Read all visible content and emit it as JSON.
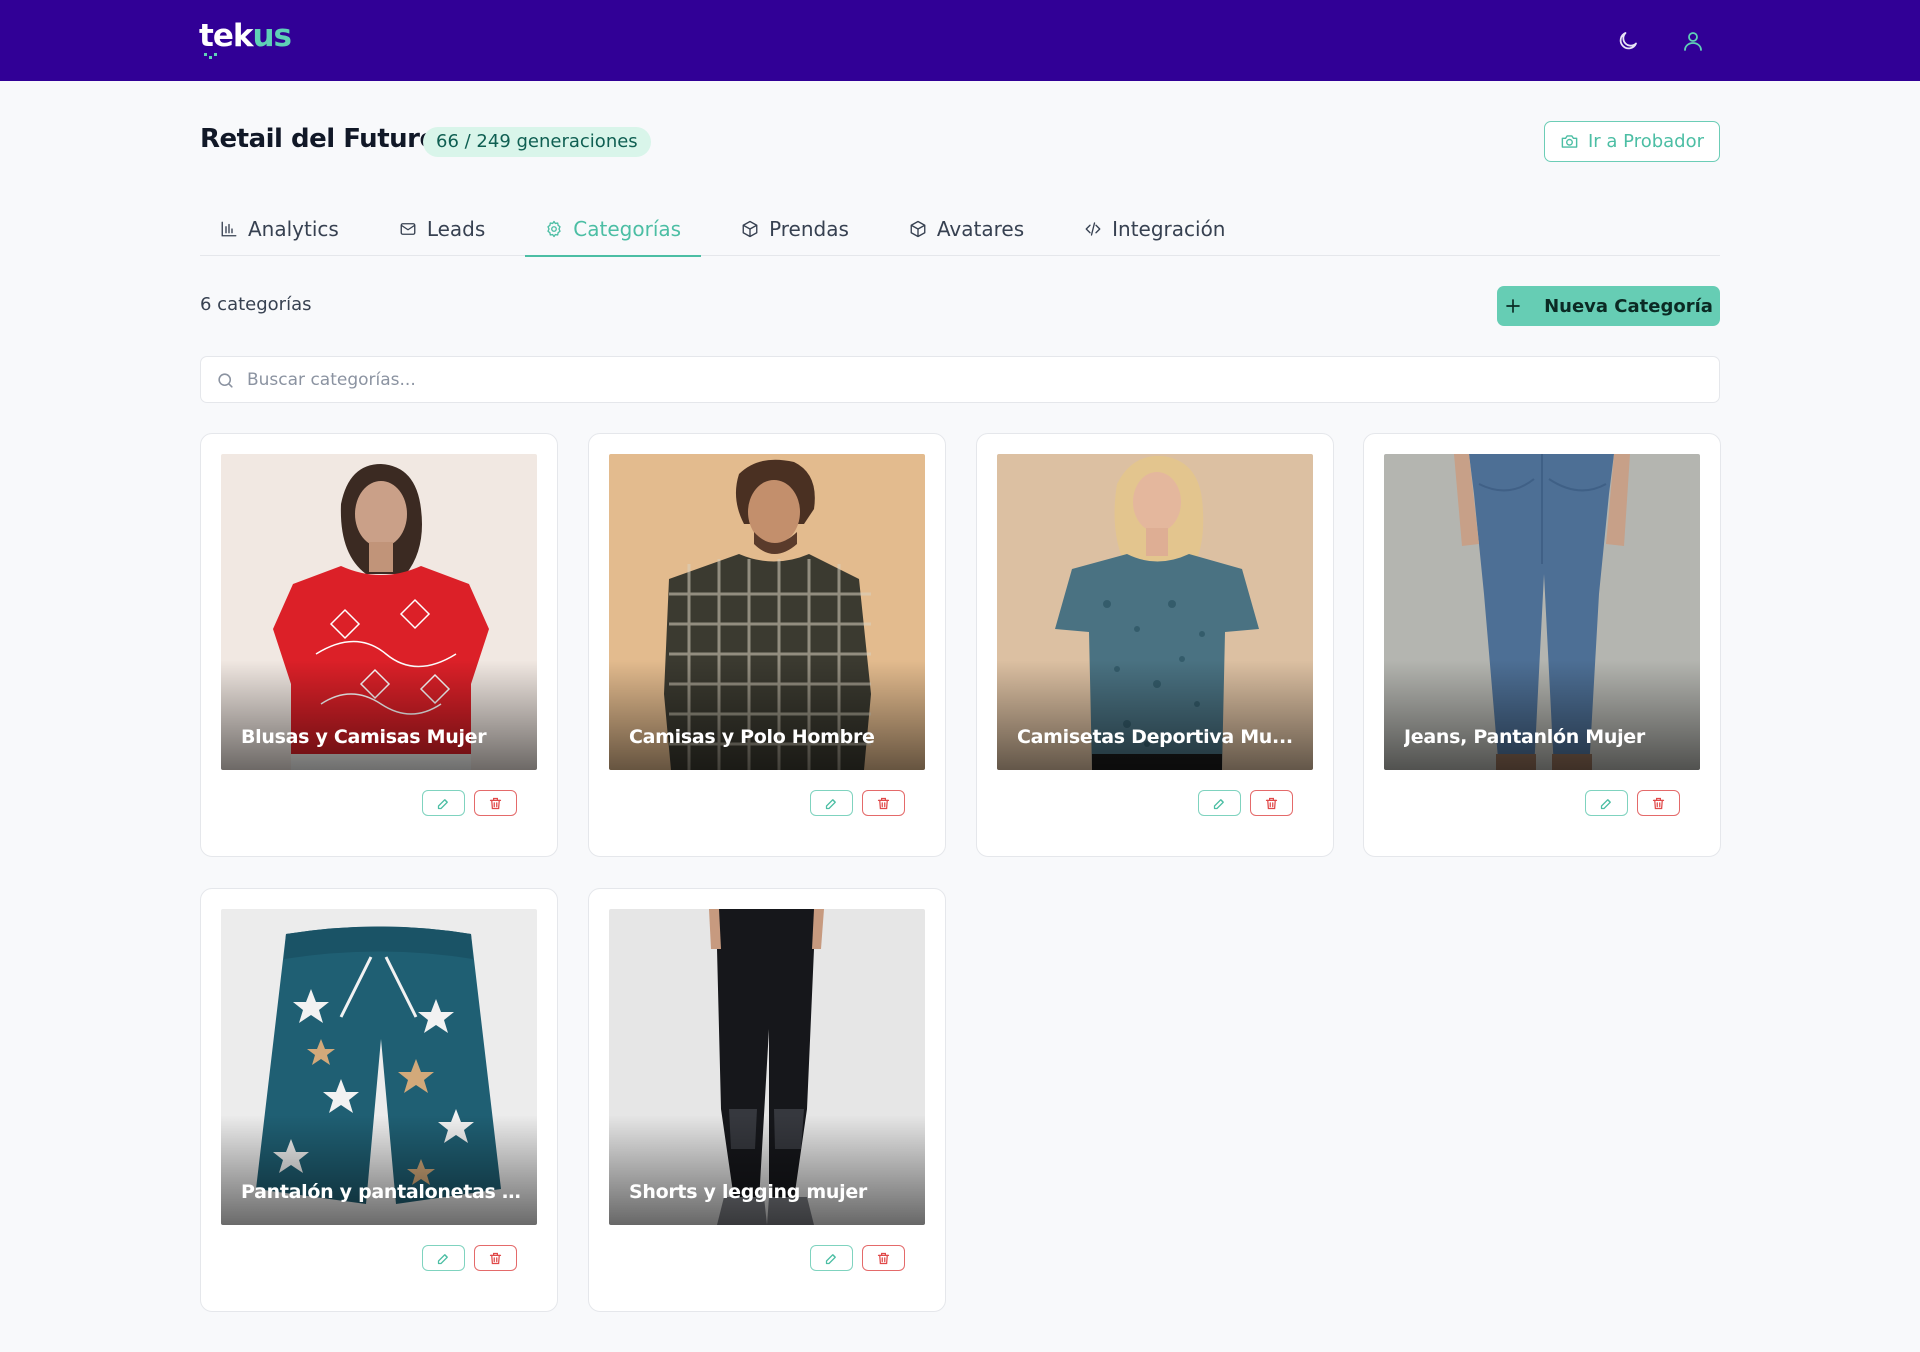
{
  "brand": {
    "logo_text_a": "tek",
    "logo_text_b": "us",
    "colors": {
      "topbar": "#310096",
      "accent": "#66cdb4",
      "danger": "#e46a6a"
    }
  },
  "topbar": {
    "icons": [
      "moon-icon",
      "user-icon"
    ]
  },
  "header": {
    "title": "Retail del Futuro",
    "generations": "66 / 249 generaciones",
    "probador_label": "Ir a Probador"
  },
  "tabs": [
    {
      "label": "Analytics",
      "icon": "bar-chart-icon",
      "active": false
    },
    {
      "label": "Leads",
      "icon": "mail-icon",
      "active": false
    },
    {
      "label": "Categorías",
      "icon": "gear-icon",
      "active": true
    },
    {
      "label": "Prendas",
      "icon": "box-icon",
      "active": false
    },
    {
      "label": "Avatares",
      "icon": "box-icon",
      "active": false
    },
    {
      "label": "Integración",
      "icon": "code-icon",
      "active": false
    }
  ],
  "toolbar": {
    "count": "6 categorías",
    "new_label": "Nueva Categoría"
  },
  "search": {
    "placeholder": "Buscar categorías...",
    "value": ""
  },
  "categories": [
    {
      "name": "Blusas y Camisas Mujer",
      "image": "woman-red-blouse"
    },
    {
      "name": "Camisas y Polo Hombre",
      "image": "man-plaid-shirt"
    },
    {
      "name": "Camisetas Deportiva Mu...",
      "image": "woman-blue-tshirt"
    },
    {
      "name": "Jeans, Pantanlón Mujer",
      "image": "woman-blue-jeans"
    },
    {
      "name": "Pantalón y pantalonetas ...",
      "image": "star-print-shorts"
    },
    {
      "name": "Shorts y legging mujer",
      "image": "black-leggings"
    }
  ]
}
